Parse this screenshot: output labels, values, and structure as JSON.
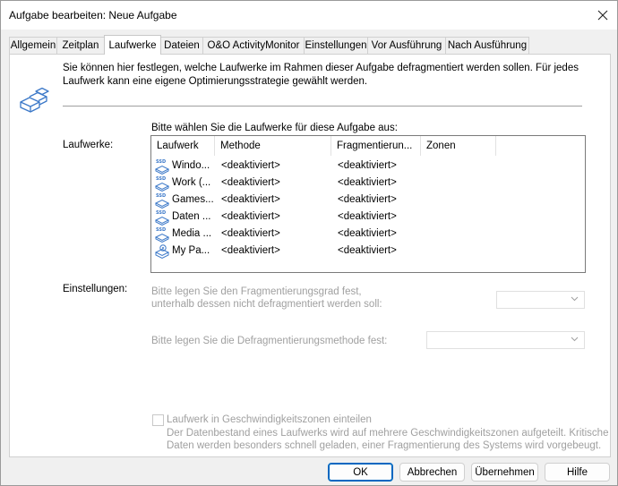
{
  "window": {
    "title": "Aufgabe bearbeiten: Neue Aufgabe"
  },
  "tabs": [
    {
      "label": "Allgemein",
      "active": false
    },
    {
      "label": "Zeitplan",
      "active": false
    },
    {
      "label": "Laufwerke",
      "active": true
    },
    {
      "label": "Dateien",
      "active": false
    },
    {
      "label": "O&O ActivityMonitor",
      "active": false
    },
    {
      "label": "Einstellungen",
      "active": false
    },
    {
      "label": "Vor Ausführung",
      "active": false
    },
    {
      "label": "Nach Ausführung",
      "active": false
    }
  ],
  "intro": {
    "line1": "Sie können hier festlegen, welche Laufwerke im Rahmen dieser Aufgabe defragmentiert werden sollen. Für jedes",
    "line2": "Laufwerk kann eine eigene Optimierungsstrategie gewählt werden.",
    "icon": "drive-stack-icon"
  },
  "drives_section": {
    "label": "Laufwerke:",
    "prompt": "Bitte wählen Sie die Laufwerke für diese Aufgabe aus:",
    "columns": [
      "Laufwerk",
      "Methode",
      "Fragmentierun...",
      "Zonen"
    ],
    "rows": [
      {
        "name": "Windo...",
        "method": "<deaktiviert>",
        "fragmentation": "<deaktiviert>",
        "zones": "",
        "icon": "ssd-drive-icon"
      },
      {
        "name": "Work (...",
        "method": "<deaktiviert>",
        "fragmentation": "<deaktiviert>",
        "zones": "",
        "icon": "ssd-drive-icon"
      },
      {
        "name": "Games...",
        "method": "<deaktiviert>",
        "fragmentation": "<deaktiviert>",
        "zones": "",
        "icon": "ssd-drive-icon"
      },
      {
        "name": "Daten ...",
        "method": "<deaktiviert>",
        "fragmentation": "<deaktiviert>",
        "zones": "",
        "icon": "ssd-drive-icon"
      },
      {
        "name": "Media ...",
        "method": "<deaktiviert>",
        "fragmentation": "<deaktiviert>",
        "zones": "",
        "icon": "ssd-drive-icon"
      },
      {
        "name": "My Pa...",
        "method": "<deaktiviert>",
        "fragmentation": "<deaktiviert>",
        "zones": "",
        "icon": "hdd-drive-icon"
      }
    ]
  },
  "settings_section": {
    "label": "Einstellungen:",
    "frag_degree_line1": "Bitte legen Sie den Fragmentierungsgrad fest,",
    "frag_degree_line2": "unterhalb dessen nicht defragmentiert werden soll:",
    "frag_degree_value": "",
    "method_label": "Bitte legen Sie die Defragmentierungsmethode fest:",
    "method_value": ""
  },
  "zones": {
    "checkbox_label": "Laufwerk in Geschwindigkeitszonen einteilen",
    "checked": false,
    "desc_line1": "Der Datenbestand eines Laufwerks wird auf mehrere Geschwindigkeitszonen aufgeteilt. Kritische",
    "desc_line2": "Daten werden besonders schnell geladen, einer Fragmentierung des Systems wird vorgebeugt."
  },
  "buttons": {
    "ok": "OK",
    "cancel": "Abbrechen",
    "apply": "Übernehmen",
    "help": "Hilfe"
  },
  "colors": {
    "accent": "#0067c0",
    "disabled_text": "#a0a0a0",
    "icon_blue": "#3b78c8"
  }
}
